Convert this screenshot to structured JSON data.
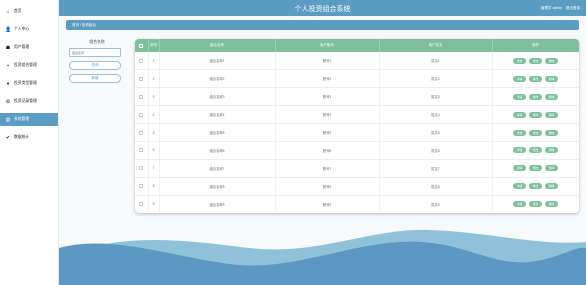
{
  "app": {
    "title": "个人投资组合系统"
  },
  "header": {
    "user_text": "管理员 admin",
    "logout": "退出登录"
  },
  "sidebar": {
    "items": [
      {
        "label": "首页",
        "icon": "home-icon",
        "glyph": "⌂",
        "active": false
      },
      {
        "label": "个人中心",
        "icon": "user-icon",
        "glyph": "👤",
        "active": false
      },
      {
        "label": "用户管理",
        "icon": "users-icon",
        "glyph": "☗",
        "active": false
      },
      {
        "label": "投资组合管理",
        "icon": "folder-icon",
        "glyph": "▪",
        "active": false
      },
      {
        "label": "投资类型管理",
        "icon": "tag-icon",
        "glyph": "♦",
        "active": false
      },
      {
        "label": "投资记录管理",
        "icon": "list-icon",
        "glyph": "⚙",
        "active": false
      },
      {
        "label": "系统管理",
        "icon": "settings-icon",
        "glyph": "▤",
        "active": true
      },
      {
        "label": "数据统计",
        "icon": "chart-icon",
        "glyph": "✔",
        "active": false
      }
    ]
  },
  "breadcrumb": {
    "text": "首页 / 投资组合"
  },
  "search": {
    "label": "组合名称",
    "placeholder": "组合名称",
    "search_button": "查询",
    "add_button": "新增"
  },
  "table": {
    "columns": [
      "",
      "序号",
      "组合名称",
      "用户账号",
      "用户姓名",
      "操作"
    ],
    "actions": {
      "detail": "详情",
      "edit": "修改",
      "delete": "删除"
    },
    "rows": [
      {
        "index": "1",
        "name": "组合名称1",
        "account": "账号1",
        "username": "姓名1"
      },
      {
        "index": "2",
        "name": "组合名称2",
        "account": "账号2",
        "username": "姓名2"
      },
      {
        "index": "3",
        "name": "组合名称3",
        "account": "账号3",
        "username": "姓名3"
      },
      {
        "index": "4",
        "name": "组合名称4",
        "account": "账号4",
        "username": "姓名4"
      },
      {
        "index": "5",
        "name": "组合名称5",
        "account": "账号5",
        "username": "姓名5"
      },
      {
        "index": "6",
        "name": "组合名称6",
        "account": "账号6",
        "username": "姓名6"
      },
      {
        "index": "7",
        "name": "组合名称7",
        "account": "账号7",
        "username": "姓名7"
      },
      {
        "index": "8",
        "name": "组合名称8",
        "account": "账号8",
        "username": "姓名8"
      },
      {
        "index": "9",
        "name": "组合名称9",
        "account": "账号9",
        "username": "姓名9"
      }
    ]
  },
  "colors": {
    "primary": "#5b9cc3",
    "header_green": "#7fbf9c",
    "button_green": "#7fbf9c",
    "wave_dark": "#5d98c2",
    "wave_light": "#8fc2d8"
  }
}
